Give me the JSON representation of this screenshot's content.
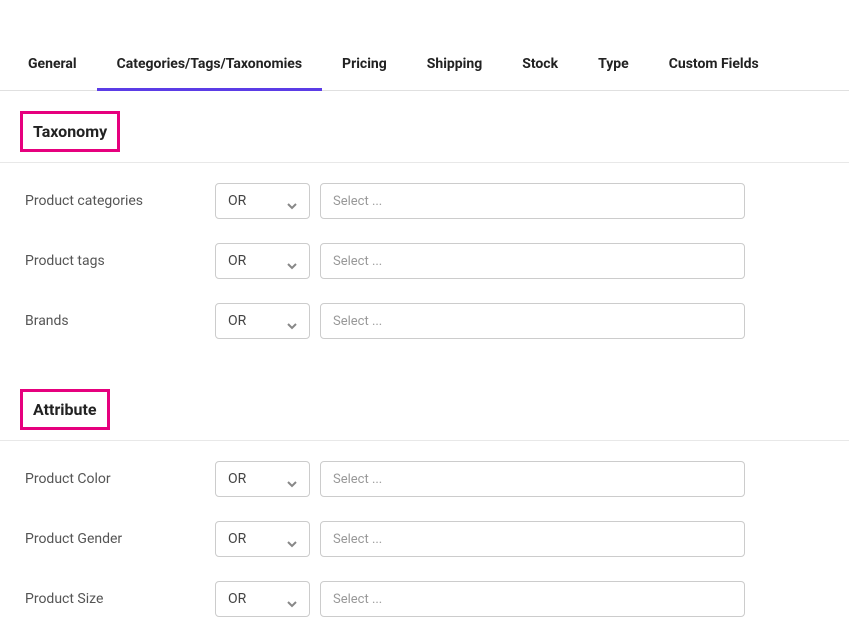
{
  "tabs": [
    {
      "label": "General",
      "active": false
    },
    {
      "label": "Categories/Tags/Taxonomies",
      "active": true
    },
    {
      "label": "Pricing",
      "active": false
    },
    {
      "label": "Shipping",
      "active": false
    },
    {
      "label": "Stock",
      "active": false
    },
    {
      "label": "Type",
      "active": false
    },
    {
      "label": "Custom Fields",
      "active": false
    }
  ],
  "sections": {
    "taxonomy": {
      "heading": "Taxonomy",
      "rows": [
        {
          "label": "Product categories",
          "logic": "OR",
          "placeholder": "Select ..."
        },
        {
          "label": "Product tags",
          "logic": "OR",
          "placeholder": "Select ..."
        },
        {
          "label": "Brands",
          "logic": "OR",
          "placeholder": "Select ..."
        }
      ]
    },
    "attribute": {
      "heading": "Attribute",
      "rows": [
        {
          "label": "Product Color",
          "logic": "OR",
          "placeholder": "Select ..."
        },
        {
          "label": "Product Gender",
          "logic": "OR",
          "placeholder": "Select ..."
        },
        {
          "label": "Product Size",
          "logic": "OR",
          "placeholder": "Select ..."
        }
      ]
    }
  }
}
